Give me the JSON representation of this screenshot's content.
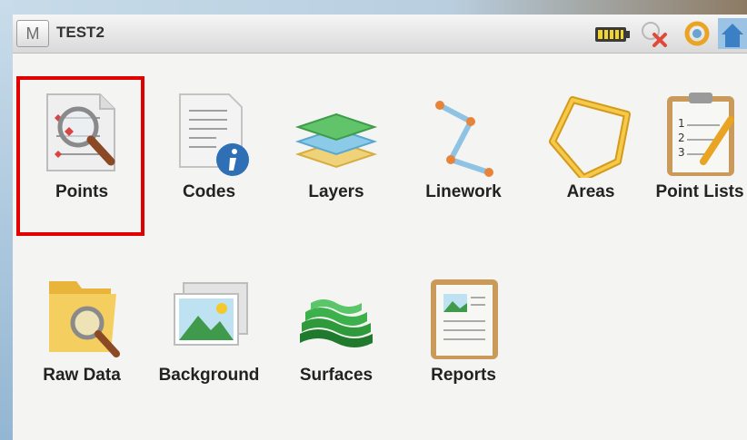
{
  "app": {
    "menu_button_label": "M",
    "title": "TEST2"
  },
  "status_icons": [
    "battery-icon",
    "gps-disconnected-icon",
    "sync-icon",
    "home-icon"
  ],
  "tiles": [
    {
      "label": "Points",
      "icon": "points-magnifier-icon"
    },
    {
      "label": "Codes",
      "icon": "codes-info-icon"
    },
    {
      "label": "Layers",
      "icon": "layers-icon"
    },
    {
      "label": "Linework",
      "icon": "linework-icon"
    },
    {
      "label": "Areas",
      "icon": "areas-icon"
    },
    {
      "label": "Point Lists",
      "icon": "point-lists-icon"
    },
    {
      "label": "Raw Data",
      "icon": "raw-data-icon"
    },
    {
      "label": "Background",
      "icon": "background-image-icon"
    },
    {
      "label": "Surfaces",
      "icon": "surfaces-icon"
    },
    {
      "label": "Reports",
      "icon": "reports-icon"
    }
  ],
  "selected_tile": "Points",
  "colors": {
    "selection": "#e00000",
    "accent_orange": "#e8833a"
  }
}
